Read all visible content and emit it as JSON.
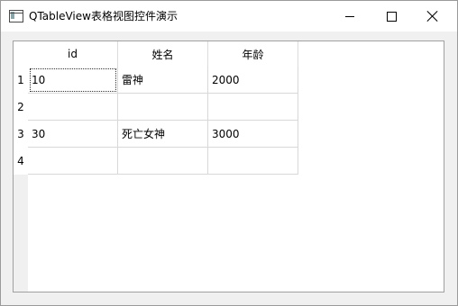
{
  "window": {
    "title": "QTableView表格视图控件演示"
  },
  "table": {
    "columns": [
      "id",
      "姓名",
      "年龄"
    ],
    "row_headers": [
      "1",
      "2",
      "3",
      "4"
    ],
    "rows": [
      [
        "10",
        "雷神",
        "2000"
      ],
      [
        "",
        "",
        ""
      ],
      [
        "30",
        "死亡女神",
        "3000"
      ],
      [
        "",
        "",
        ""
      ]
    ],
    "current_cell": "row 1, id"
  }
}
